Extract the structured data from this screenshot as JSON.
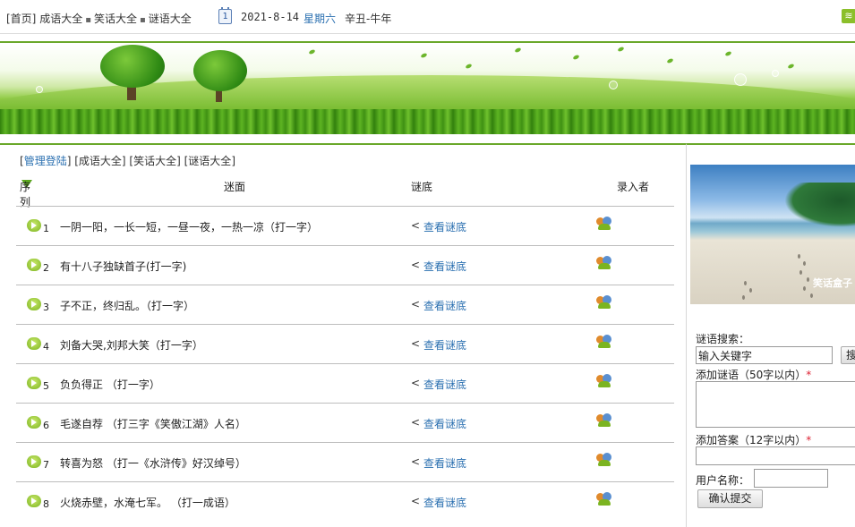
{
  "topbar": {
    "home_label": "[首页]",
    "links": [
      "成语大全",
      "笑话大全",
      "谜语大全"
    ],
    "calendar_day": "1",
    "date": "2021-8-14",
    "weekday": "星期六",
    "lunar": "辛丑-牛年"
  },
  "section_links": {
    "admin_login": "管理登陆",
    "idioms": "成语大全",
    "jokes": "笑话大全",
    "riddles": "谜语大全"
  },
  "table": {
    "headers": {
      "order": "序列",
      "riddle": "迷面",
      "answer": "谜底",
      "author": "录入者"
    },
    "answer_link": "查看谜底",
    "rows": [
      {
        "num": "1",
        "riddle": "一阴一阳，一长一短，一昼一夜，一热一凉（打一字）"
      },
      {
        "num": "2",
        "riddle": "有十八子独缺首子(打一字)"
      },
      {
        "num": "3",
        "riddle": "子不正，终归乱。（打一字）"
      },
      {
        "num": "4",
        "riddle": "刘备大哭,刘邦大笑（打一字）"
      },
      {
        "num": "5",
        "riddle": "负负得正 （打一字）"
      },
      {
        "num": "6",
        "riddle": "毛遂自荐 （打三字《笑傲江湖》人名）"
      },
      {
        "num": "7",
        "riddle": "转喜为怒 （打一《水浒传》好汉绰号）"
      },
      {
        "num": "8",
        "riddle": "火烧赤壁，水淹七军。 （打一成语）"
      }
    ]
  },
  "sidebar": {
    "search_label": "谜语搜索：",
    "search_value": "输入关键字",
    "search_button": "搜",
    "add_riddle_label": "添加谜语（50字以内）",
    "add_answer_label": "添加答案（12字以内）",
    "required_mark": "*",
    "username_label": "用户名称：",
    "submit_button": "确认提交",
    "image_watermark": "笑话盒子"
  },
  "colors": {
    "link": "#2a6fb0",
    "accent_green": "#6aa82a",
    "required": "#d23"
  }
}
